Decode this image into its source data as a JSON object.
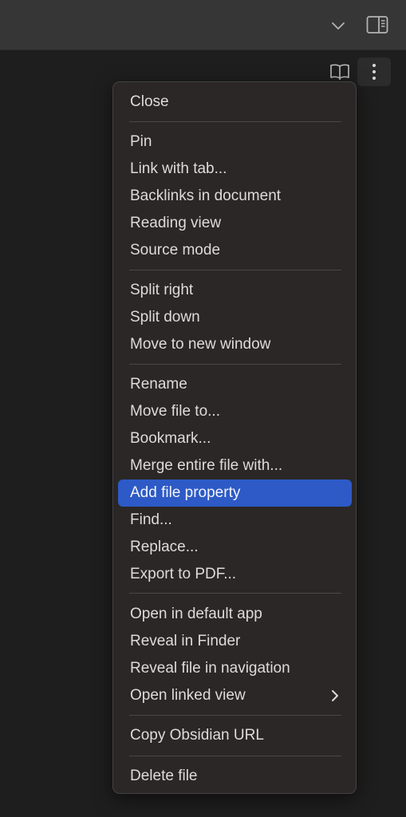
{
  "topbar": {
    "icons": {
      "tab_list": "chevron-down-icon",
      "right_sidebar": "sidebar-toggle-icon"
    }
  },
  "view_header": {
    "icons": {
      "reading_view": "book-open-icon",
      "more_options": "more-vertical-icon"
    }
  },
  "menu": {
    "active_item": "Add file property",
    "colors": {
      "background": "#2a2726",
      "highlight": "#2d5ac6"
    },
    "items": [
      {
        "label": "Close"
      },
      {
        "label": "Pin"
      },
      {
        "label": "Link with tab..."
      },
      {
        "label": "Backlinks in document"
      },
      {
        "label": "Reading view"
      },
      {
        "label": "Source mode"
      },
      {
        "label": "Split right"
      },
      {
        "label": "Split down"
      },
      {
        "label": "Move to new window"
      },
      {
        "label": "Rename"
      },
      {
        "label": "Move file to..."
      },
      {
        "label": "Bookmark..."
      },
      {
        "label": "Merge entire file with..."
      },
      {
        "label": "Add file property"
      },
      {
        "label": "Find..."
      },
      {
        "label": "Replace..."
      },
      {
        "label": "Export to PDF..."
      },
      {
        "label": "Open in default app"
      },
      {
        "label": "Reveal in Finder"
      },
      {
        "label": "Reveal file in navigation"
      },
      {
        "label": "Open linked view",
        "submenu_icon": "chevron-right-icon"
      },
      {
        "label": "Copy Obsidian URL"
      },
      {
        "label": "Delete file"
      }
    ]
  }
}
